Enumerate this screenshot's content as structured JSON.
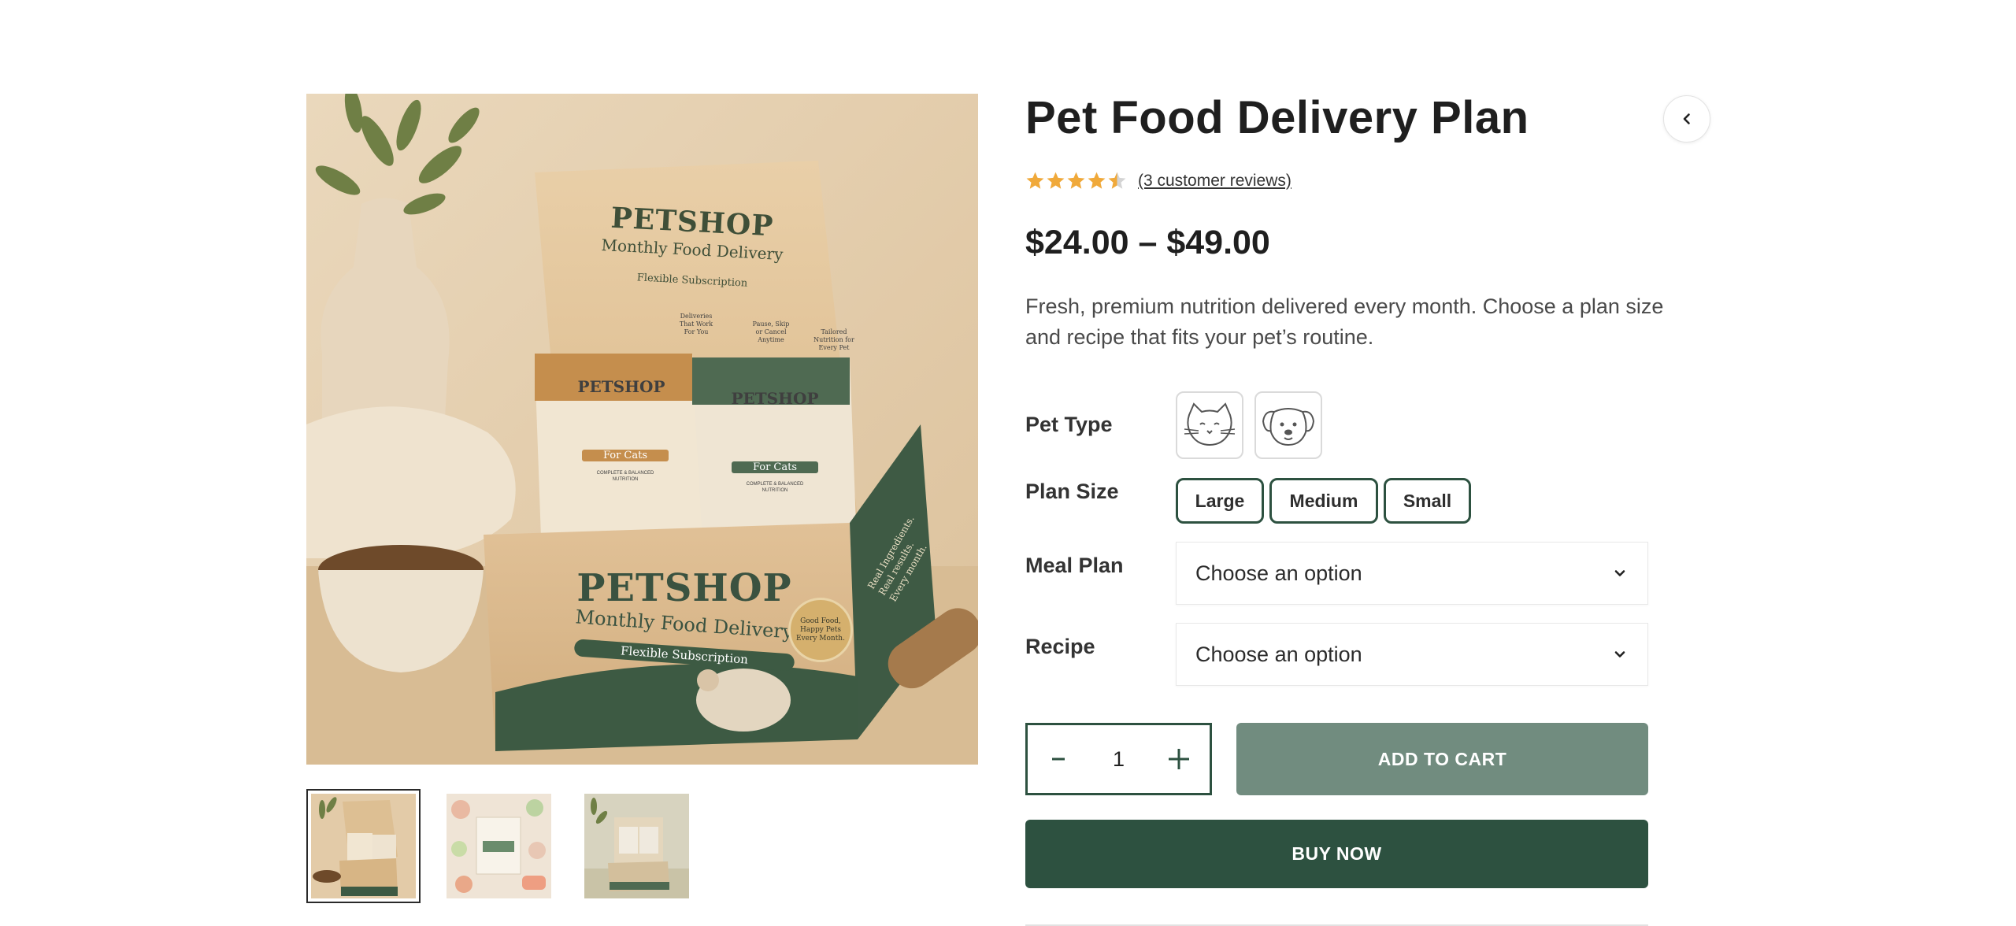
{
  "product": {
    "title": "Pet Food Delivery Plan",
    "rating": 4.5,
    "rating_max": 5,
    "reviews_link": "(3 customer reviews)",
    "price_range": "$24.00 – $49.00",
    "description": "Fresh, premium nutrition delivered every month. Choose a plan size and recipe that fits your pet’s routine."
  },
  "gallery": {
    "main_image": {
      "icon": "product-box-image",
      "brand": "PETSHOP",
      "lid_title": "Monthly Food Delivery",
      "lid_subtitle": "Flexible Subscription",
      "lid_features": [
        [
          "Deliveries",
          "That Work",
          "For You"
        ],
        [
          "Pause, Skip",
          "or Cancel",
          "Anytime"
        ],
        [
          "Tailored",
          "Nutrition for",
          "Every Pet"
        ]
      ],
      "bag_left_label": "For Cats",
      "bag_right_label": "For Cats",
      "bag_tagline_1": "COMPLETE & BALANCED",
      "bag_tagline_2": "NUTRITION",
      "box_title": "Monthly Food Delivery",
      "box_subtitle": "Flexible Subscription",
      "badge_lines": [
        "Good Food,",
        "Happy Pets",
        "Every Month."
      ],
      "box_side": [
        "Real Ingredients.",
        "Real results.",
        "Every month."
      ]
    },
    "thumbnails": [
      {
        "icon": "box-thumbnail",
        "active": true
      },
      {
        "icon": "ingredients-thumbnail",
        "active": false
      },
      {
        "icon": "packages-thumbnail",
        "active": false
      }
    ]
  },
  "options": {
    "pet_type": {
      "label": "Pet Type",
      "swatches": [
        {
          "icon": "cat-icon"
        },
        {
          "icon": "dog-icon"
        }
      ]
    },
    "plan_size": {
      "label": "Plan Size",
      "choices": [
        "Large",
        "Medium",
        "Small"
      ]
    },
    "meal_plan": {
      "label": "Meal Plan",
      "value": "Choose an option"
    },
    "recipe": {
      "label": "Recipe",
      "value": "Choose an option"
    }
  },
  "cart": {
    "quantity": "1",
    "add_to_cart": "ADD TO CART",
    "buy_now": "BUY NOW"
  },
  "colors": {
    "primary": "#2d5140",
    "add_to_cart_bg": "#718c7f",
    "star": "#f0a93a"
  }
}
